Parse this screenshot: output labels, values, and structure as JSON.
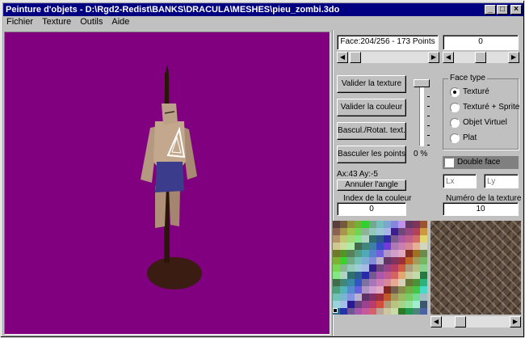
{
  "window": {
    "title": "Peinture d'objets - D:\\Rgd2-Redist\\BANKS\\DRACULA\\MESHES\\pieu_zombi.3do",
    "minimize_glyph": "_",
    "maximize_glyph": "□",
    "close_glyph": "×"
  },
  "menu": {
    "items": [
      "Fichier",
      "Texture",
      "Outils",
      "Aide"
    ]
  },
  "panel": {
    "face_info": "Face:204/256 - 173 Points",
    "face_value": "0",
    "buttons": {
      "validate_texture": "Valider la texture",
      "validate_color": "Valider la couleur",
      "toggle_rotate_texture": "Bascul./Rotat. text.",
      "toggle_points": "Basculer les points",
      "cancel_angle": "Annuler l'angle"
    },
    "slider_percent_label": "0 %",
    "slider_percent": 0,
    "face_type": {
      "title": "Face type",
      "options": [
        "Texturé",
        "Texturé + Sprite",
        "Objet Virtuel",
        "Plat"
      ],
      "selected_index": 0
    },
    "double_face_label": "Double face",
    "lx_placeholder": "Lx",
    "ly_placeholder": "Ly",
    "angle_text": "Ax:43 Ay:-5",
    "color_index_label": "Index de la couleur",
    "color_index_value": "0",
    "texture_number_label": "Numéro de la texture",
    "texture_number_value": "10"
  },
  "colors": {
    "viewport_bg": "#800080",
    "titlebar_bg": "#000080"
  }
}
